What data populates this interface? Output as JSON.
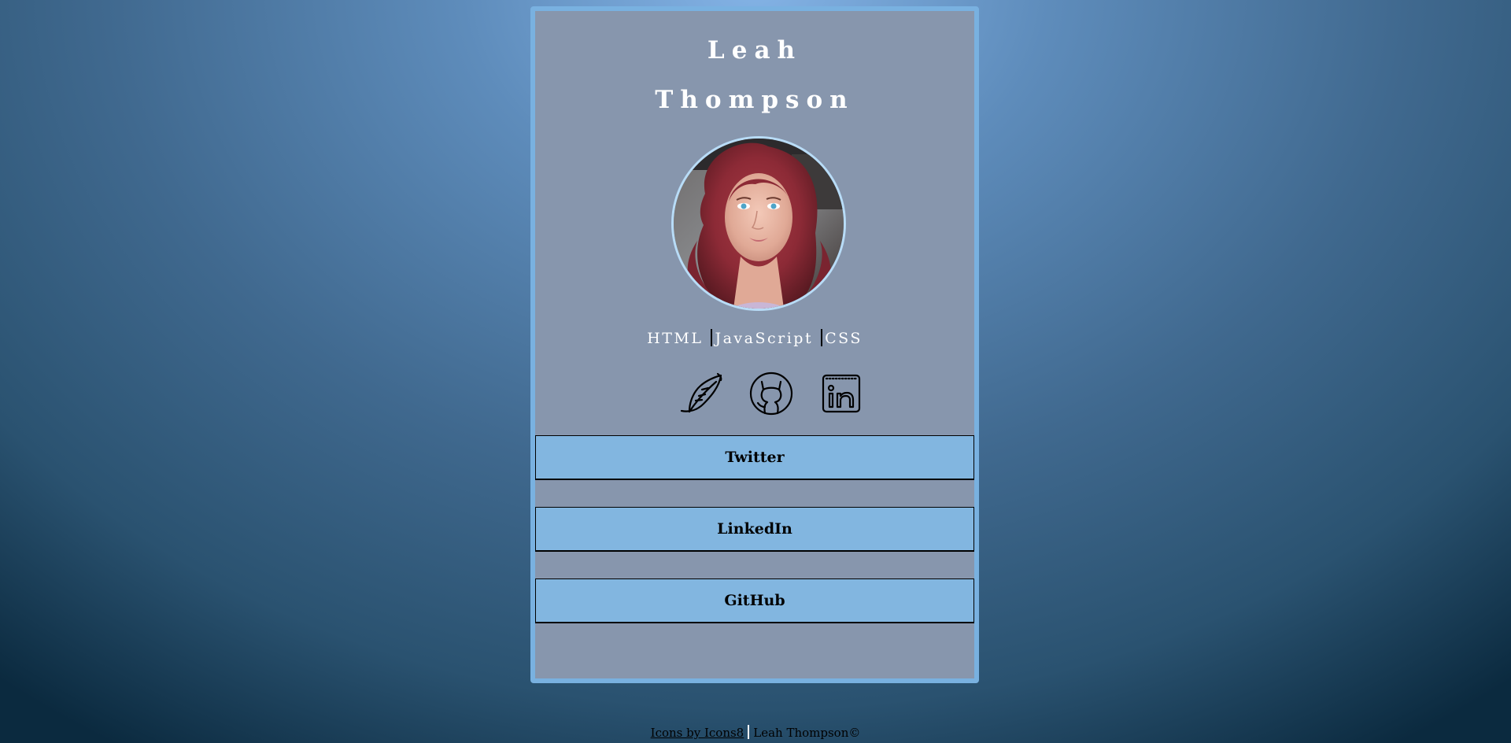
{
  "profile": {
    "first_name": "Leah",
    "last_name": "Thompson",
    "avatar_alt": "profile-photo"
  },
  "skills": [
    "HTML",
    "JavaScript",
    "CSS"
  ],
  "social_icons": [
    {
      "name": "feather-icon"
    },
    {
      "name": "github-cat-icon"
    },
    {
      "name": "linkedin-icon"
    }
  ],
  "buttons": {
    "twitter": "Twitter",
    "linkedin": "LinkedIn",
    "github": "GitHub"
  },
  "footer": {
    "credit_link": "Icons by Icons8",
    "copyright": "Leah Thompson©"
  },
  "colors": {
    "card_bg": "#8796ad",
    "card_border": "#79b1e0",
    "button_bg": "#82b6e0",
    "text_light": "#ffffff"
  }
}
